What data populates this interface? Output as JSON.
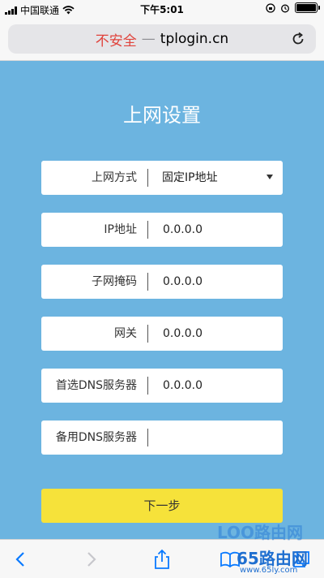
{
  "status": {
    "carrier": "中国联通",
    "time": "下午5:01"
  },
  "address": {
    "insecure": "不安全",
    "separator": "—",
    "domain": "tplogin.cn"
  },
  "page": {
    "title": "上网设置",
    "fields": [
      {
        "label": "上网方式",
        "value": "固定IP地址"
      },
      {
        "label": "IP地址",
        "value": "0.0.0.0"
      },
      {
        "label": "子网掩码",
        "value": "0.0.0.0"
      },
      {
        "label": "网关",
        "value": "0.0.0.0"
      },
      {
        "label": "首选DNS服务器",
        "value": "0.0.0.0"
      },
      {
        "label": "备用DNS服务器",
        "value": ""
      }
    ],
    "next_button": "下一步"
  },
  "watermark": {
    "line1": "LOO路由网",
    "line2": "65路由网",
    "line3": "www.65ly.com"
  },
  "colors": {
    "background": "#6cb4e0",
    "button": "#f6e23a",
    "insecure": "#e0433c",
    "ios_blue": "#0a7aff"
  },
  "icons": [
    "wifi-icon",
    "reload-icon",
    "back-icon",
    "forward-icon",
    "share-icon",
    "bookmarks-icon",
    "tabs-icon"
  ]
}
